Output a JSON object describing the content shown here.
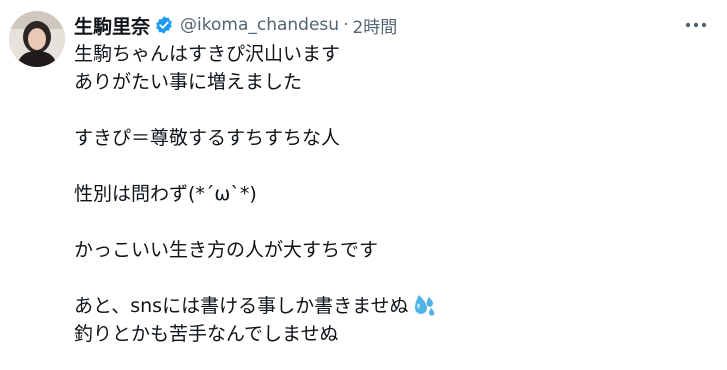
{
  "user": {
    "display_name": "生駒里奈",
    "handle": "@ikoma_chandesu",
    "separator": "·",
    "time": "2時間"
  },
  "icons": {
    "verified": "verified-badge-icon",
    "more": "more-options-icon",
    "emoji": "sweat-droplets-emoji"
  },
  "colors": {
    "verified": "#1d9bf0",
    "secondary_text": "#536471",
    "emoji": "#4fb3e6"
  },
  "tweet": {
    "lines": [
      "生駒ちゃんはすきぴ沢山います",
      "ありがたい事に増えました",
      "",
      "すきぴ＝尊敬するすちすちな人",
      "",
      "性別は問わず(*´ω`*)",
      "",
      "かっこいい生き方の人が大すちです",
      "",
      "あと、snsには書ける事しか書きませぬ",
      "釣りとかも苦手なんでしませぬ"
    ]
  }
}
